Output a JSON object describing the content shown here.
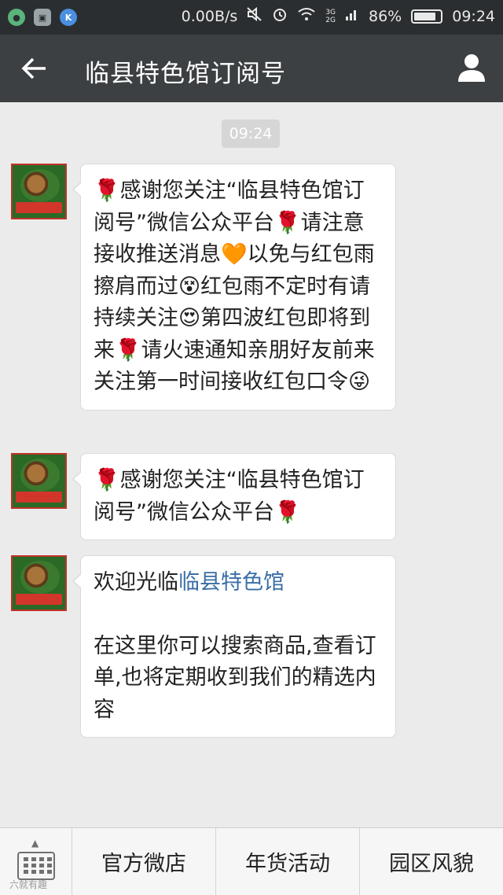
{
  "status_bar": {
    "left_icons": [
      "wechat-status-icon",
      "image-status-icon",
      "k-app-status-icon"
    ],
    "k_letter": "K",
    "network_speed": "0.00B/s",
    "signal_label_top": "3G",
    "signal_label_bottom": "2G",
    "battery": "86%",
    "battery_level": 0.86,
    "time": "09:24"
  },
  "header": {
    "title": "临县特色馆订阅号",
    "back_icon": "back-arrow-icon",
    "profile_icon": "person-icon"
  },
  "chat": {
    "timestamp": "09:24",
    "messages": [
      {
        "text": "🌹感谢您关注“临县特色馆订阅号”微信公众平台🌹请注意接收推送消息🧡以免与红包雨擦肩而过😵红包雨不定时有请持续关注😍第四波红包即将到来🌹请火速通知亲朋好友前来关注第一时间接收红包口令😜"
      },
      {
        "text": "🌹感谢您关注“临县特色馆订阅号”微信公众平台🌹"
      },
      {
        "prefix": "欢迎光临",
        "link": "临县特色馆",
        "body": "在这里你可以搜索商品,查看订单,也将定期收到我们的精选内容"
      }
    ]
  },
  "bottom_menu": {
    "keyboard_icon": "keyboard-icon",
    "items": [
      "官方微店",
      "年货活动",
      "园区风貌"
    ],
    "watermark": "六就有趣"
  }
}
